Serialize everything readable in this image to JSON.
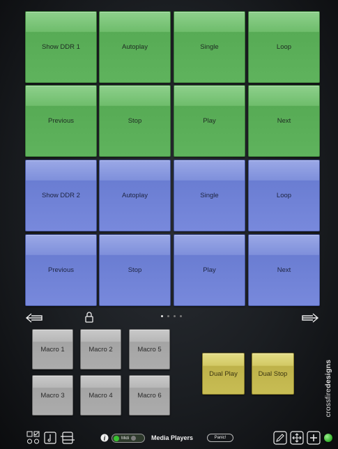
{
  "grid": {
    "green_rows": [
      [
        "Show DDR 1",
        "Autoplay",
        "Single",
        "Loop"
      ],
      [
        "Previous",
        "Stop",
        "Play",
        "Next"
      ]
    ],
    "blue_rows": [
      [
        "Show DDR 2",
        "Autoplay",
        "Single",
        "Loop"
      ],
      [
        "Previous",
        "Stop",
        "Play",
        "Next"
      ]
    ],
    "colors": {
      "green": "#5fb35d",
      "blue": "#7889dc"
    }
  },
  "nav": {
    "left_icon": "arrow-left-icon",
    "lock_icon": "lock-icon",
    "right_icon": "arrow-right-icon",
    "page_count": 4,
    "active_page": 1
  },
  "macros": {
    "buttons": [
      "Macro 1",
      "Macro 2",
      "Macro 5",
      "Macro 3",
      "Macro 4",
      "Macro 6"
    ],
    "dual_play": "Dual Play",
    "dual_stop": "Dual Stop",
    "gray": "#acacac",
    "yellow": "#c8bd54"
  },
  "branding": {
    "prefix": "crossfire",
    "suffix": "designs"
  },
  "bottom_bar": {
    "midi_label": "Midi",
    "title": "Media Players",
    "panic_label": "Panic!",
    "icons_left": [
      "grid-edit-icon",
      "note-icon",
      "layout-icon"
    ],
    "info_icon": "info-icon",
    "icons_right": [
      "pencil-icon",
      "move-icon",
      "add-icon"
    ]
  }
}
